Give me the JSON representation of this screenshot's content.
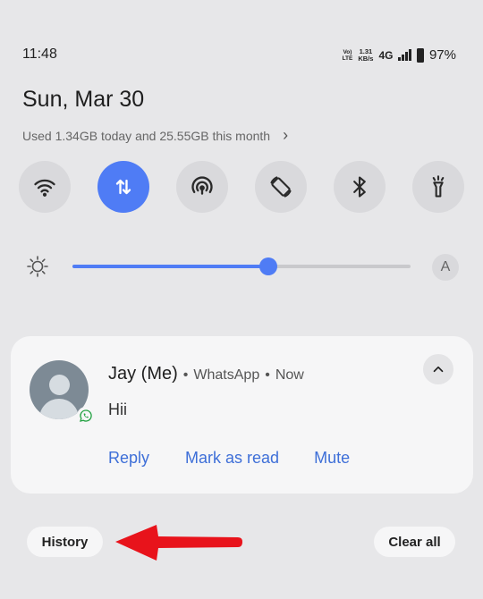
{
  "status_bar": {
    "time": "11:48",
    "volte_top": "Vo)",
    "volte_bottom": "LTE",
    "speed_value": "1.31",
    "speed_unit": "KB/s",
    "network": "4G",
    "battery": "97%"
  },
  "panel": {
    "date": "Sun, Mar 30",
    "data_usage": "Used 1.34GB today and 25.55GB this month"
  },
  "quick_tiles": [
    {
      "name": "wifi",
      "active": false
    },
    {
      "name": "mobile-data",
      "active": true
    },
    {
      "name": "hotspot",
      "active": false
    },
    {
      "name": "auto-rotate",
      "active": false
    },
    {
      "name": "bluetooth",
      "active": false
    },
    {
      "name": "flashlight",
      "active": false
    }
  ],
  "brightness": {
    "level": 0.58,
    "auto_label": "A"
  },
  "notification": {
    "sender": "Jay (Me)",
    "app": "WhatsApp",
    "time": "Now",
    "separator": "•",
    "message": "Hii",
    "actions": [
      "Reply",
      "Mark as read",
      "Mute"
    ]
  },
  "footer": {
    "history_label": "History",
    "clear_all_label": "Clear all"
  },
  "colors": {
    "accent": "#4f7cf5",
    "action_text": "#3e6fd8",
    "arrow": "#e8131b",
    "whatsapp": "#25a244"
  }
}
